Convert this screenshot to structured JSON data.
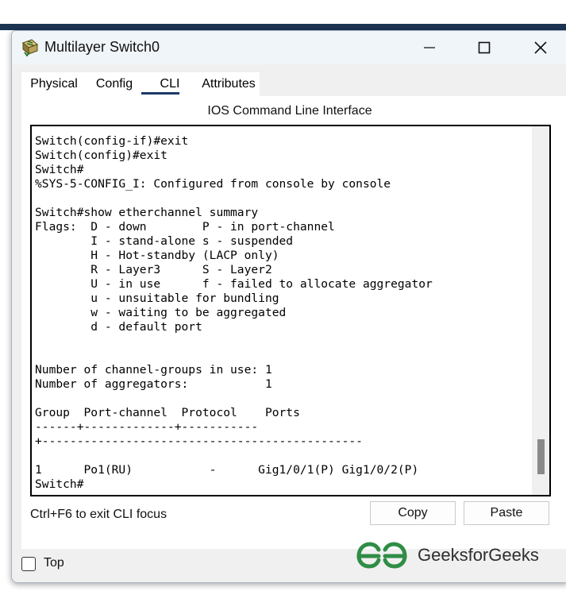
{
  "window": {
    "title": "Multilayer Switch0",
    "icon": "multilayer-switch-icon",
    "controls": [
      "minimize-icon",
      "maximize-icon",
      "close-icon"
    ]
  },
  "tabs": [
    {
      "label": "Physical",
      "selected": false
    },
    {
      "label": "Config",
      "selected": false
    },
    {
      "label": "CLI",
      "selected": true
    },
    {
      "label": "Attributes",
      "selected": false
    }
  ],
  "panel": {
    "title": "IOS Command Line Interface"
  },
  "console": {
    "text": "Switch(config-if)#exit\nSwitch(config)#exit\nSwitch#\n%SYS-5-CONFIG_I: Configured from console by console\n\nSwitch#show etherchannel summary\nFlags:  D - down        P - in port-channel\n        I - stand-alone s - suspended\n        H - Hot-standby (LACP only)\n        R - Layer3      S - Layer2\n        U - in use      f - failed to allocate aggregator\n        u - unsuitable for bundling\n        w - waiting to be aggregated\n        d - default port\n\n\nNumber of channel-groups in use: 1\nNumber of aggregators:           1\n\nGroup  Port-channel  Protocol    Ports\n------+-------------+-----------\n+----------------------------------------------\n\n1      Po1(RU)           -      Gig1/0/1(P) Gig1/0/2(P)\nSwitch#"
  },
  "footer": {
    "hint": "Ctrl+F6 to exit CLI focus",
    "copy_label": "Copy",
    "paste_label": "Paste",
    "top_label": "Top",
    "top_checked": false
  },
  "watermark": {
    "text": "GeeksforGeeks",
    "color": "#2f8d46"
  }
}
